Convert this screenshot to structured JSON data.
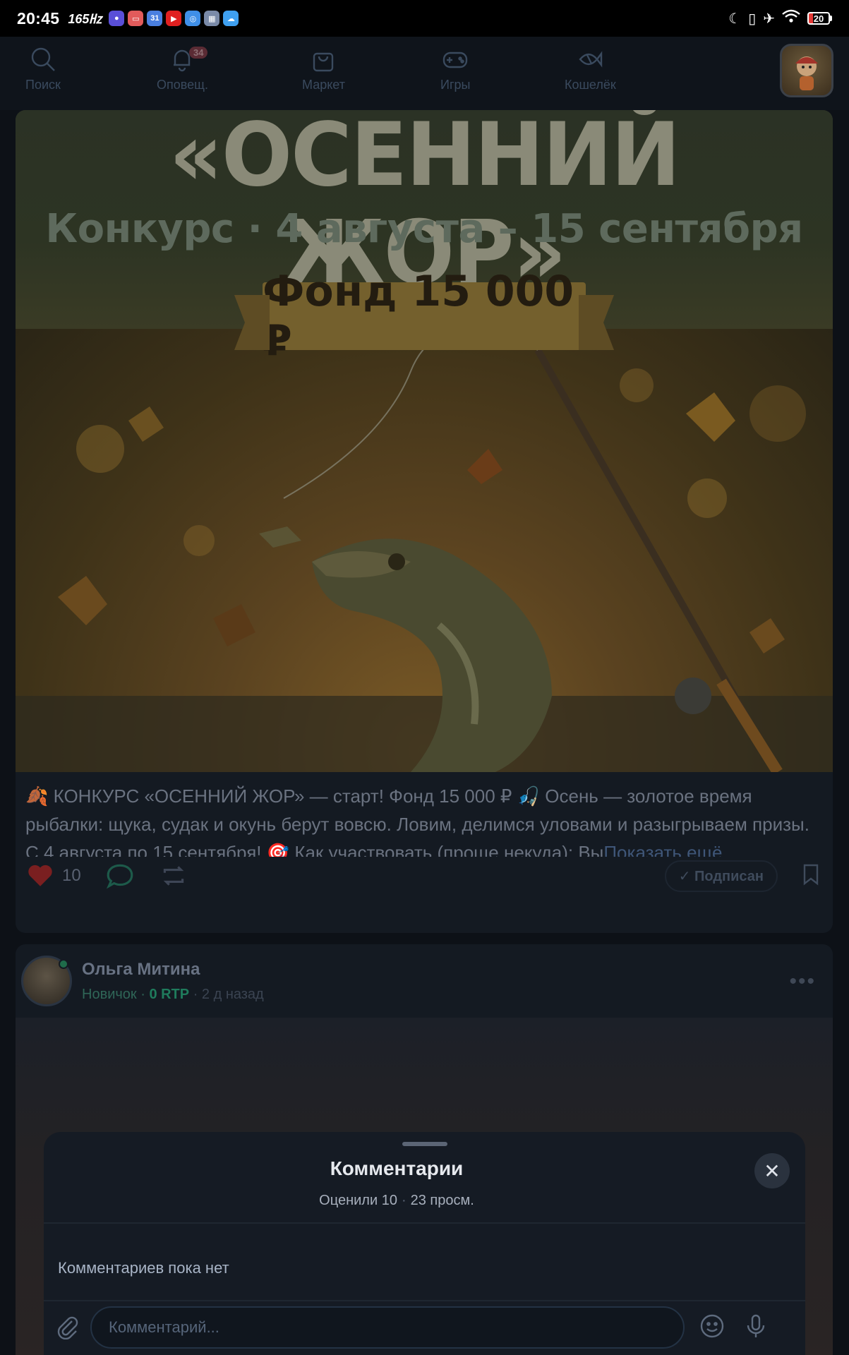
{
  "status_bar": {
    "time": "20:45",
    "rate": "165㎐",
    "battery": "20"
  },
  "nav": {
    "items": [
      {
        "label": "Поиск",
        "icon": "search-icon"
      },
      {
        "label": "Оповещ.",
        "icon": "bell-icon",
        "badge": "34"
      },
      {
        "label": "Маркет",
        "icon": "shopping-bag-icon"
      },
      {
        "label": "Игры",
        "icon": "gamepad-icon"
      },
      {
        "label": "Кошелёк",
        "icon": "wallet-fish-icon"
      }
    ]
  },
  "post1": {
    "banner_title": "«ОСЕННИЙ ЖОР»",
    "banner_subtitle": "Конкурс · 4 августа – 15 сентября",
    "banner_fund": "Фонд 15 000 ₽",
    "text": "🍂 КОНКУРС «ОСЕННИЙ ЖОР» — старт! Фонд 15 000 ₽ 🎣 Осень — золотое время рыбалки: щука, судак и окунь берут вовсю. Ловим, делимся уловами и разыгрываем призы. С 4 августа по 15 сентября! 🎯 Как участвовать (проще некуда): Вы",
    "show_more": "Показать ещё",
    "likes": "10",
    "subscribed_label": "✓ Подписан"
  },
  "post2": {
    "author_name": "Ольга Митина",
    "author_rank": "Новичок",
    "author_rtp": "0 RTP",
    "posted": "2 д назад"
  },
  "comments_sheet": {
    "title": "Комментарии",
    "rated": "Оценили 10",
    "views": "23 просм.",
    "empty_text": "Комментариев пока нет",
    "input_placeholder": "Комментарий..."
  },
  "colors": {
    "accent": "#1f7b5c",
    "like": "#e53935",
    "background": "#0d1117"
  }
}
